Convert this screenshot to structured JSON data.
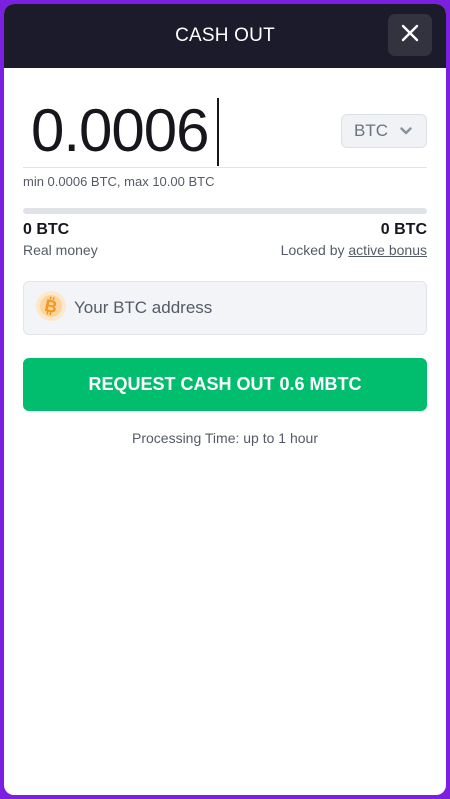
{
  "header": {
    "title": "CASH OUT",
    "close_icon": "close-icon"
  },
  "amount": {
    "value": "0.0006",
    "currency": "BTC",
    "limits": "min 0.0006 BTC, max 10.00 BTC"
  },
  "balance": {
    "real_value": "0 BTC",
    "real_label": "Real money",
    "locked_value": "0 BTC",
    "locked_label_prefix": "Locked by",
    "locked_link": "active bonus"
  },
  "address": {
    "icon": "bitcoin-icon",
    "placeholder": "Your BTC address",
    "value": ""
  },
  "action": {
    "label": "REQUEST CASH OUT 0.6 MBTC"
  },
  "processing_time": "Processing Time: up to 1 hour",
  "colors": {
    "frame": "#7b1fe0",
    "header": "#1c1b2b",
    "primary_button": "#01bd6e",
    "bitcoin": "#f7931a"
  }
}
